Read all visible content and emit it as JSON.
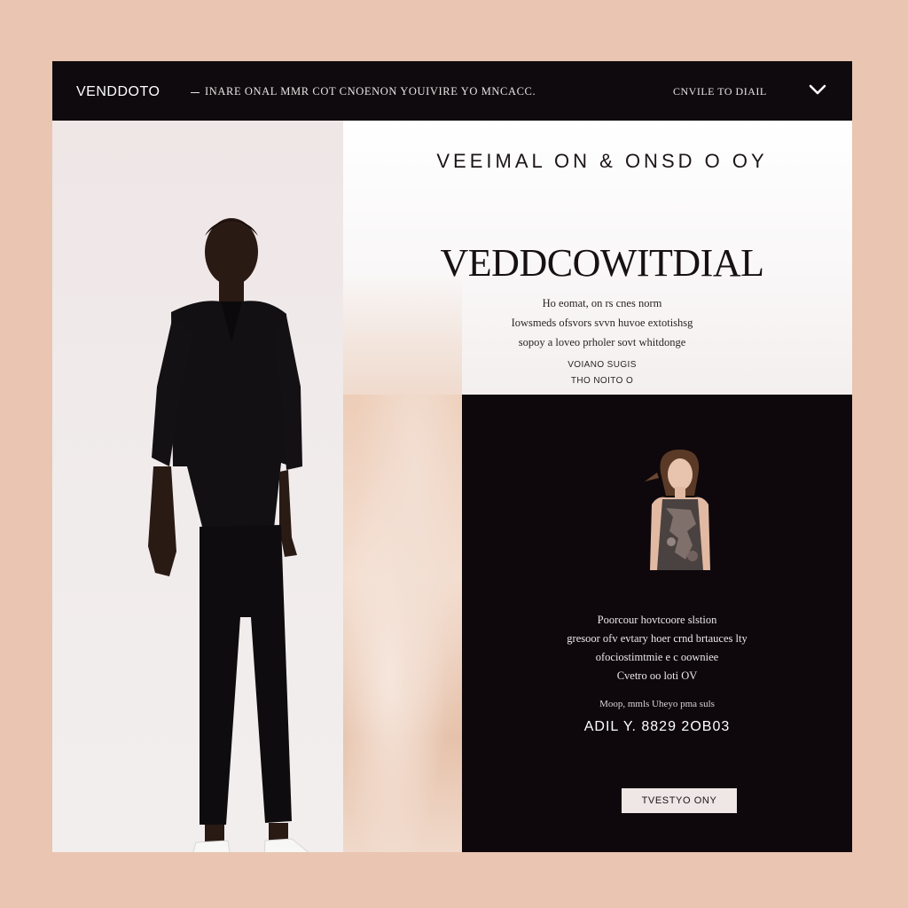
{
  "header": {
    "logo": "VENDDOTO",
    "promo": "INARE ONAL MMR COT CNOENON YOUIVIRE YO MNCACC.",
    "cta": "CNVILE TO DIAIL"
  },
  "hero": {
    "tagline": "VEEIMAL ON & ONSD O OY",
    "headline": "VEDDCOWITDIAL",
    "description": [
      "Ho eomat, on rs cnes norm",
      "Iowsmeds ofsvors svvn huvoe extotishsg",
      "sopoy a loveo prholer sovt whitdonge"
    ],
    "link_lines": [
      "VOIANO SUGIS",
      "THO NOITO O"
    ]
  },
  "product_card": {
    "text": [
      "Poorcour hovtcoore slstion",
      "gresoor ofv evtary hoer crnd brtauces lty",
      "ofociostimtmie e c oowniee",
      "Cvetro oo loti OV"
    ],
    "meta": "Moop, mmls Uheyo pma suls",
    "price": "ADIL Y. 8829 2OB03",
    "button_label": "TVESTYO ONY"
  },
  "colors": {
    "page_bg": "#e9c5b2",
    "topbar_bg": "#0f0a0d",
    "dark_panel": "#0e080c",
    "button_bg": "#efe6e6"
  },
  "icons": {
    "chevron": "chevron-down-icon"
  }
}
